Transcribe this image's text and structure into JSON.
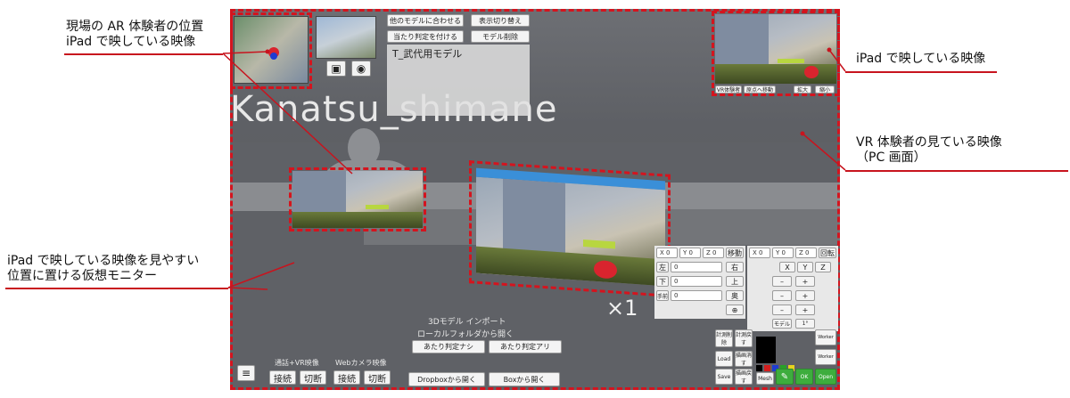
{
  "annotations": {
    "ar_position": [
      "現場の AR 体験者の位置",
      "iPad で映している映像"
    ],
    "ipad_view": "iPad で映している映像",
    "vr_view": [
      "VR 体験者の見ている映像",
      "（PC 画面）"
    ],
    "monitor": [
      "iPad で映している映像を見やすい",
      "位置に置ける仮想モニター"
    ]
  },
  "scene": {
    "user_label": "Kanatsu_shimane",
    "scale_label": "×1"
  },
  "top_menu": {
    "fit_model": "他のモデルに合わせる",
    "toggle_display": "表示切り替え",
    "add_collision": "当たり判定を付ける",
    "delete_model": "モデル削除",
    "model_name": "T_武代用モデル"
  },
  "preview": {
    "vr_user": "VR体験者",
    "move_origin": "原点へ移動",
    "zoom_in": "拡大",
    "zoom_out": "縮小"
  },
  "transform": {
    "move_headers": [
      "X 0",
      "Y 0",
      "Z 0"
    ],
    "move_label": "移動",
    "rows": [
      {
        "label": "左",
        "value": "0",
        "btn": "右"
      },
      {
        "label": "下",
        "value": "0",
        "btn": "上"
      },
      {
        "label": "手前",
        "value": "0",
        "btn": "奥"
      }
    ],
    "extra_btn": "⊕",
    "rot_headers": [
      "X 0",
      "Y 0",
      "Z 0"
    ],
    "rot_label": "回転",
    "axes": [
      "X",
      "Y",
      "Z"
    ],
    "minus": "–",
    "plus": "+",
    "model_label": "モデル",
    "degree_label": "1°"
  },
  "import": {
    "title": "3Dモデル インポート",
    "subtitle": "ローカルフォルダから開く",
    "no_collision": "あたり判定ナシ",
    "with_collision": "あたり判定アリ",
    "dropbox": "Dropboxから開く",
    "box": "Boxから開く"
  },
  "call": {
    "call_vr_label": "通話+VR映像",
    "webcam_label": "Webカメラ映像",
    "connect": "接続",
    "disconnect": "切断"
  },
  "tools": {
    "measure_delete": "計測削除",
    "measure_undo": "計測戻す",
    "load": "Load",
    "draw_erase": "描画消す",
    "draw_undo": "描画戻す",
    "save": "Save",
    "mesh": "Mesh",
    "ok": "OK",
    "open": "Open",
    "marker_label1": "Worker",
    "marker_label2": "Worker",
    "colors": [
      "#000000",
      "#d21e1e",
      "#1e3cd2",
      "#28a028",
      "#e6d21e"
    ]
  }
}
